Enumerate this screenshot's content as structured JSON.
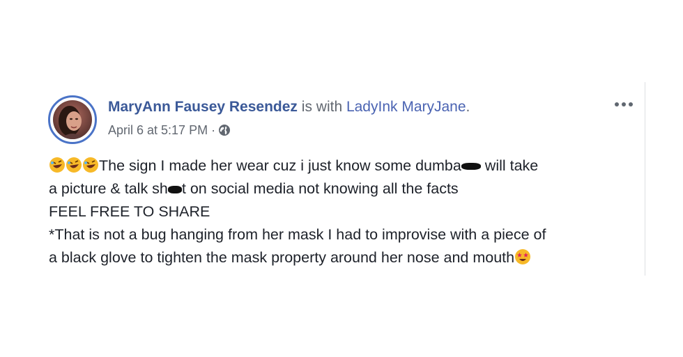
{
  "post": {
    "author": "MaryAnn Fausey Resendez",
    "with_text": " is with ",
    "tagged_user": "LadyInk MaryJane",
    "tagged_suffix": ".",
    "timestamp": "April 6 at 5:17 PM",
    "separator": "·",
    "privacy_icon": "globe-icon",
    "more_icon": "more-options-icon",
    "body": {
      "line1_text": "The sign I made her wear cuz i just know some dumba",
      "line1_end": " will take",
      "line2_start": "a picture & talk sh",
      "line2_end": "t on social media not knowing all the facts",
      "line3": "FEEL FREE TO SHARE",
      "line4": "*That is not a bug hanging from her mask I had to improvise with a piece of",
      "line5": "a black glove to tighten the mask property around her nose and mouth",
      "leading_emoji": "rolling-on-floor-laughing-emoji",
      "trailing_emoji": "star-struck-emoji"
    }
  },
  "colors": {
    "link": "#3b5998",
    "meta": "#616770",
    "text": "#1d2129",
    "avatar_ring": "#4a73c7"
  }
}
